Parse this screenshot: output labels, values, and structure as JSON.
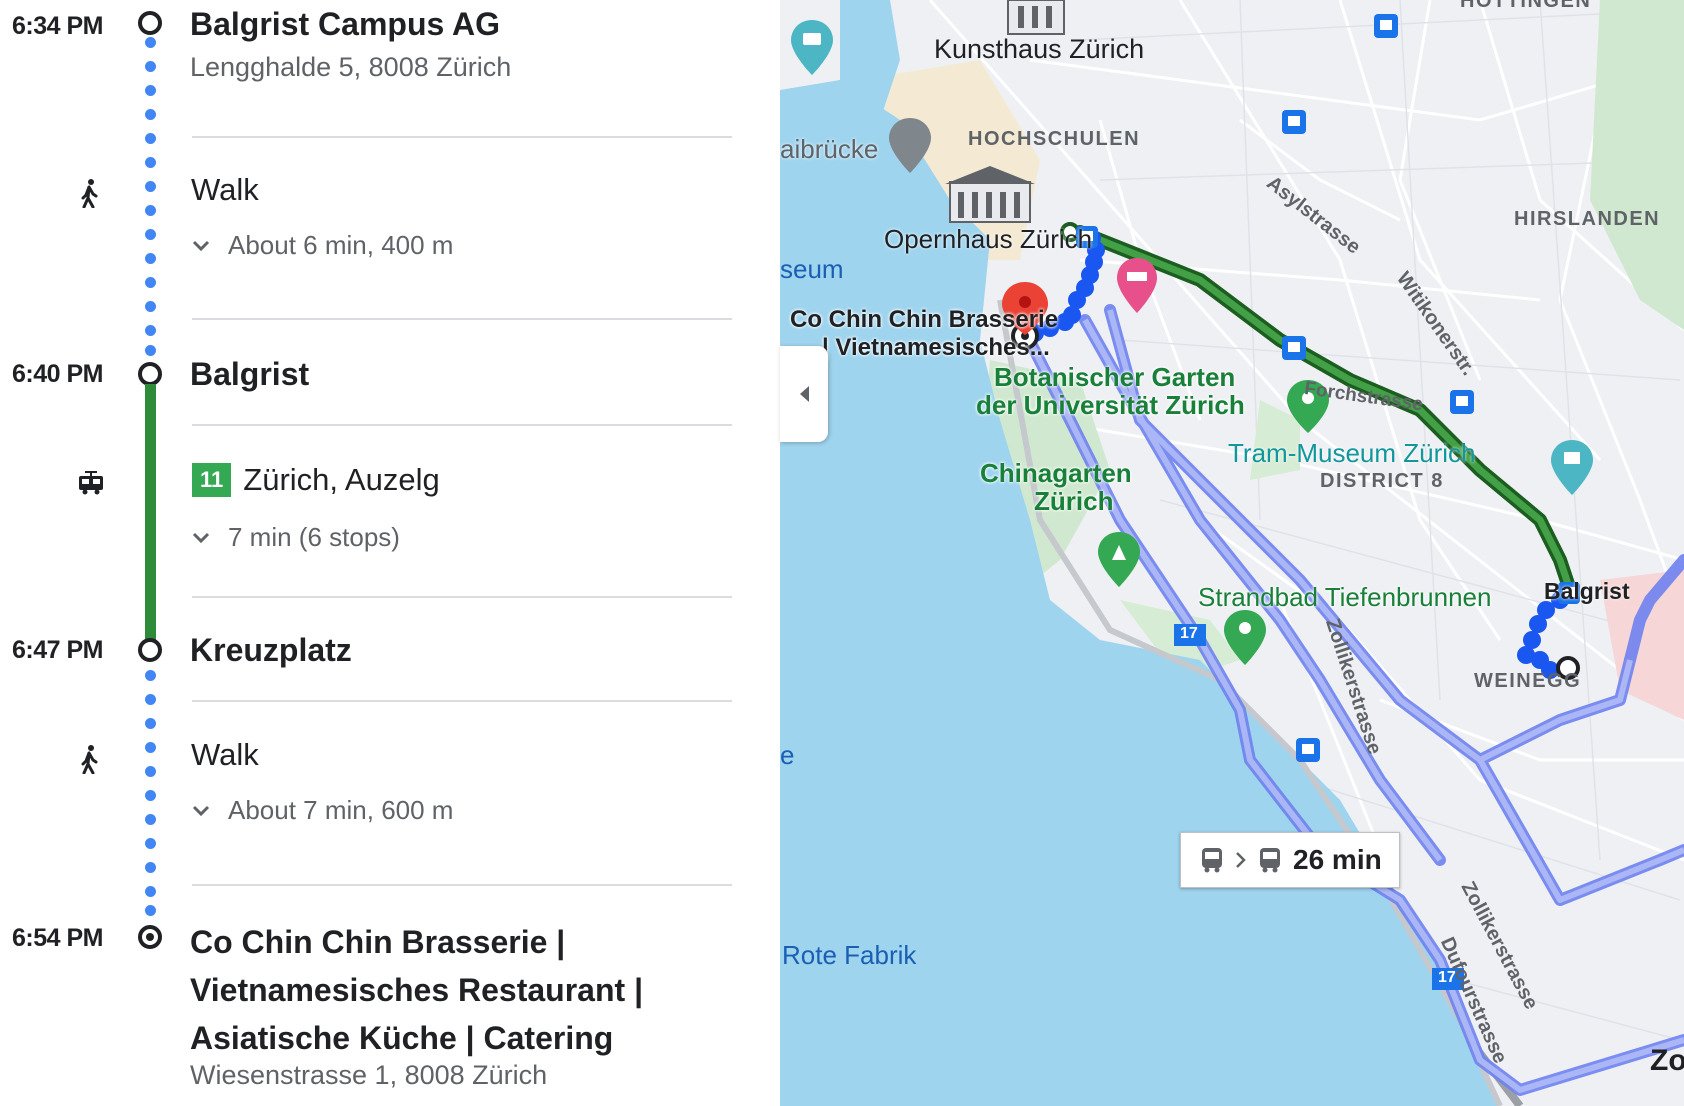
{
  "itinerary": {
    "stops": [
      {
        "time": "6:34 PM",
        "name": "Balgrist Campus AG",
        "address": "Lengghalde 5, 8008 Zürich"
      },
      {
        "time": "6:40 PM",
        "name": "Balgrist"
      },
      {
        "time": "6:47 PM",
        "name": "Kreuzplatz"
      },
      {
        "time": "6:54 PM",
        "name_lines": [
          "Co Chin Chin Brasserie |",
          "Vietnamesisches Restaurant |",
          "Asiatische Küche | Catering"
        ],
        "address": "Wiesenstrasse 1, 8008 Zürich"
      }
    ],
    "walk1": {
      "label": "Walk",
      "detail": "About 6 min, 400 m"
    },
    "tram": {
      "line": "11",
      "direction": "Zürich, Auzelg",
      "detail": "7 min (6 stops)",
      "line_color": "#34a853"
    },
    "walk2": {
      "label": "Walk",
      "detail": "About 7 min, 600 m"
    },
    "icons": {
      "walk": "walk-icon",
      "tram": "tram-icon",
      "expand": "chevron-down-icon"
    }
  },
  "map": {
    "labels": {
      "kunsthaus": "Kunsthaus Zürich",
      "hochschulen": "HOCHSCHULEN",
      "hottingen": "HOTTINGEN",
      "hirslanden": "HIRSLANDEN",
      "opernhaus": "Opernhaus Zürich",
      "quaibruecke": "aibrücke",
      "museum": "seum",
      "destination": "Co Chin Chin Brasserie",
      "destination2": "| Vietnamesisches...",
      "botanischer1": "Botanischer Garten",
      "botanischer2": "der Universität Zürich",
      "tram_museum": "Tram-Museum Zürich",
      "district8": "DISTRICT 8",
      "chinagarten1": "Chinagarten",
      "chinagarten2": "Zürich",
      "strandbad": "Strandbad Tiefenbrunnen",
      "balgrist": "Balgrist",
      "weinegg": "WEINEGG",
      "rote_fabrik": "Rote Fabrik",
      "zo": "Zo",
      "e": "e",
      "asylstrasse": "Asylstrasse",
      "witikonerstr": "Witikonerstr.",
      "forchstrasse": "Forchstrasse",
      "zollikerstrasse1": "Zollikerstrasse",
      "zollikerstrasse2": "Zollikerstrasse",
      "dufourstrasse": "Dufourstrasse",
      "road17a": "17",
      "road17b": "17"
    },
    "route_summary": {
      "duration": "26 min"
    },
    "colors": {
      "water": "#9fd4ee",
      "land": "#eef0f3",
      "park": "#c8e6c9",
      "walk_route": "#1a56f0",
      "tram_route": "#2e7d32",
      "alt_route": "#7b8ff0",
      "pin": "#ea4335"
    }
  }
}
